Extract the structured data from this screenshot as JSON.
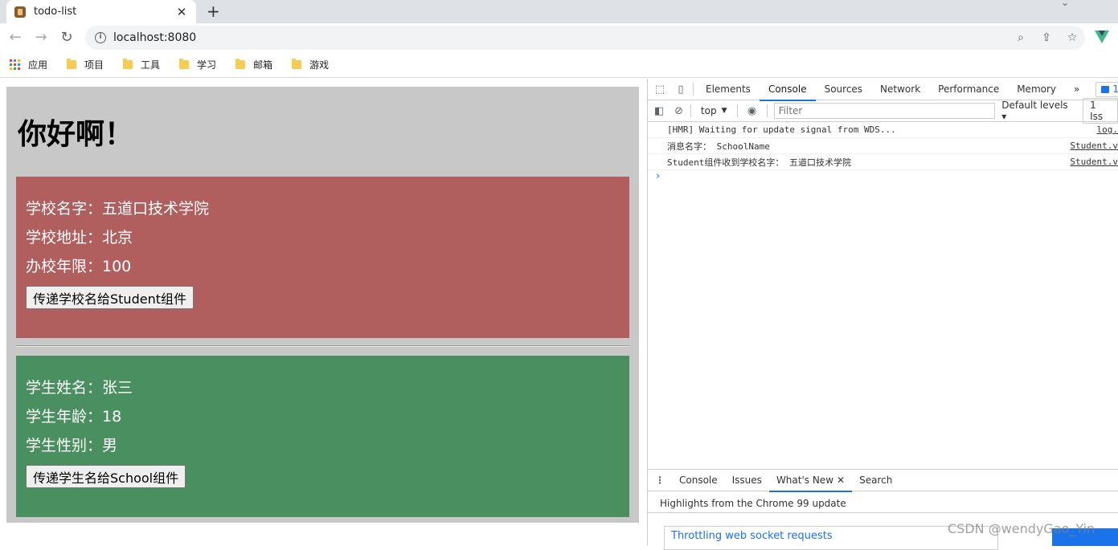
{
  "browser": {
    "tab_title": "todo-list",
    "tab_close": "✕",
    "new_tab": "+",
    "url": "localhost:8080",
    "bookmarks": [
      {
        "label": "应用",
        "icon": "apps-grid-icon"
      },
      {
        "label": "项目",
        "icon": "folder-icon"
      },
      {
        "label": "工具",
        "icon": "folder-icon"
      },
      {
        "label": "学习",
        "icon": "folder-icon"
      },
      {
        "label": "邮箱",
        "icon": "folder-icon"
      },
      {
        "label": "游戏",
        "icon": "folder-icon"
      }
    ]
  },
  "page": {
    "heading": "你好啊！",
    "school": {
      "name_line": "学校名字：五道口技术学院",
      "address_line": "学校地址：北京",
      "years_line": "办校年限：100",
      "button": "传递学校名给Student组件",
      "background": "#b05f5e"
    },
    "student": {
      "name_line": "学生姓名：张三",
      "age_line": "学生年龄：18",
      "gender_line": "学生性别：男",
      "button": "传递学生名给School组件",
      "background": "#4a8f5f"
    }
  },
  "devtools": {
    "tabs": [
      "Elements",
      "Console",
      "Sources",
      "Network",
      "Performance",
      "Memory"
    ],
    "active_tab": "Console",
    "more": "»",
    "issues_count": "1",
    "context": "top",
    "filter_placeholder": "Filter",
    "levels": "Default levels ▾",
    "issues_box": "1 Iss",
    "logs": [
      {
        "text": "[HMR] Waiting for update signal from WDS...",
        "source": "log."
      },
      {
        "text": "消息名字： SchoolName",
        "source": "Student.v"
      },
      {
        "text": "Student组件收到学校名字： 五道口技术学院",
        "source": "Student.v"
      }
    ],
    "prompt": "›",
    "drawer": {
      "tabs": [
        "Console",
        "Issues",
        "What's New",
        "Search"
      ],
      "active_tab": "What's New",
      "close": "✕",
      "highlights": "Highlights from the Chrome 99 update",
      "card_title": "Throttling web socket requests"
    }
  },
  "watermark": "CSDN @wendyGao_Yin"
}
